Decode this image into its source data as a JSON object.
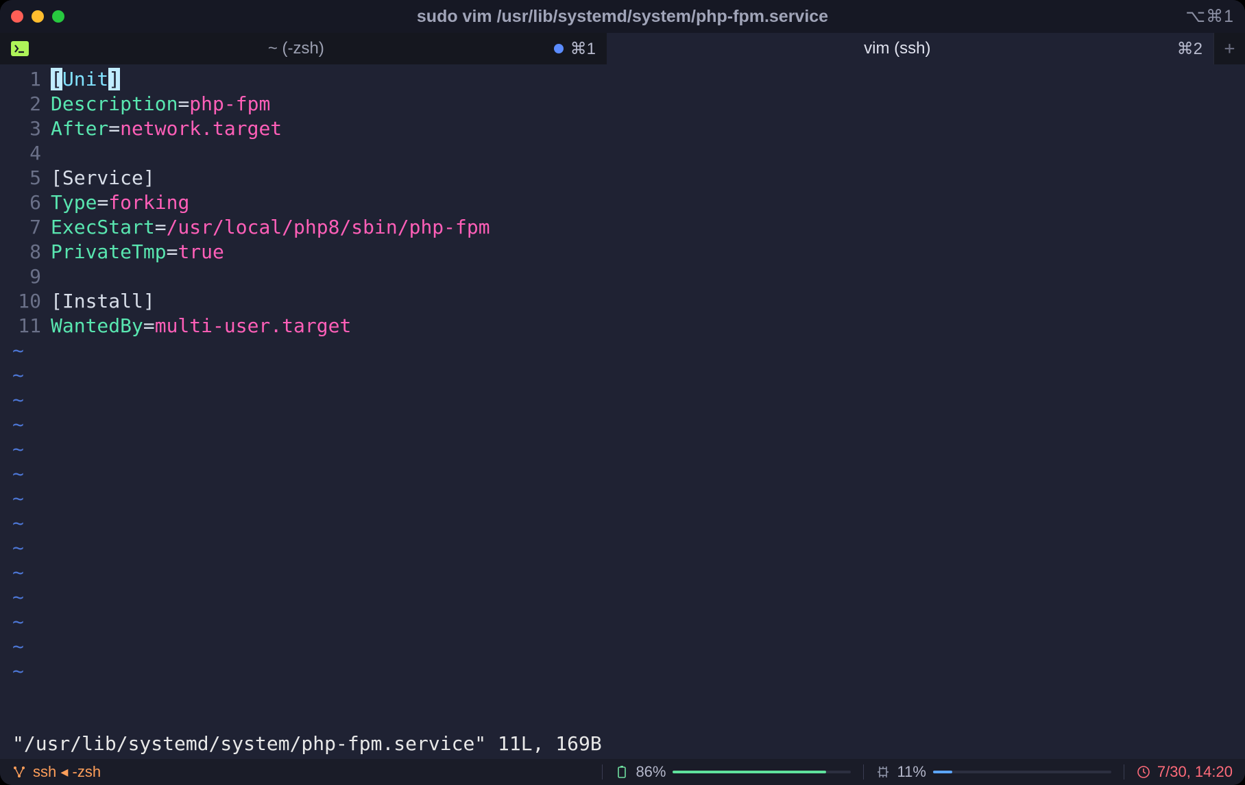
{
  "titlebar": {
    "title": "sudo vim /usr/lib/systemd/system/php-fpm.service",
    "shortcut": "⌥⌘1"
  },
  "tabs": [
    {
      "label": "~ (-zsh)",
      "shortcut": "⌘1",
      "modified": true
    },
    {
      "label": "vim (ssh)",
      "shortcut": "⌘2",
      "modified": false
    }
  ],
  "editor": {
    "lines": [
      {
        "n": "1",
        "segs": [
          [
            "hlcursor",
            "["
          ],
          [
            "c-section",
            "Unit"
          ],
          [
            "hlcursor",
            "]"
          ]
        ]
      },
      {
        "n": "2",
        "segs": [
          [
            "c-key",
            "Description"
          ],
          [
            "c-eq",
            "="
          ],
          [
            "c-val",
            "php-fpm"
          ]
        ]
      },
      {
        "n": "3",
        "segs": [
          [
            "c-key",
            "After"
          ],
          [
            "c-eq",
            "="
          ],
          [
            "c-val",
            "network.target"
          ]
        ]
      },
      {
        "n": "4",
        "segs": []
      },
      {
        "n": "5",
        "segs": [
          [
            "bracket",
            "[Service]"
          ]
        ]
      },
      {
        "n": "6",
        "segs": [
          [
            "c-key",
            "Type"
          ],
          [
            "c-eq",
            "="
          ],
          [
            "c-val",
            "forking"
          ]
        ]
      },
      {
        "n": "7",
        "segs": [
          [
            "c-key",
            "ExecStart"
          ],
          [
            "c-eq",
            "="
          ],
          [
            "c-val",
            "/usr/local/php8/sbin/php-fpm"
          ]
        ]
      },
      {
        "n": "8",
        "segs": [
          [
            "c-key",
            "PrivateTmp"
          ],
          [
            "c-eq",
            "="
          ],
          [
            "c-val",
            "true"
          ]
        ]
      },
      {
        "n": "9",
        "segs": []
      },
      {
        "n": "10",
        "segs": [
          [
            "bracket",
            "[Install]"
          ]
        ]
      },
      {
        "n": "11",
        "segs": [
          [
            "c-key",
            "WantedBy"
          ],
          [
            "c-eq",
            "="
          ],
          [
            "c-val",
            "multi-user.target"
          ]
        ]
      }
    ],
    "tilde_count": 14,
    "tilde_char": "~"
  },
  "status": "\"/usr/lib/systemd/system/php-fpm.service\" 11L, 169B",
  "bottombar": {
    "session": "ssh ◂ -zsh",
    "battery": "86%",
    "battery_pct": 86,
    "cpu": "11%",
    "cpu_pct": 11,
    "datetime": "7/30, 14:20"
  }
}
